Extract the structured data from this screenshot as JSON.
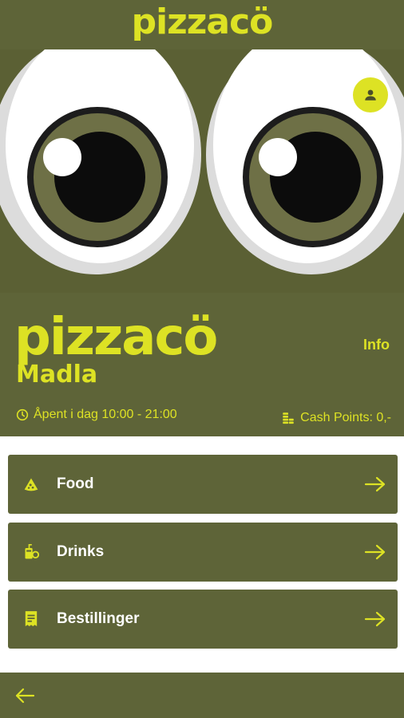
{
  "app": {
    "logo_text": "pizzacö"
  },
  "hero": {
    "profile_icon": "person-icon"
  },
  "restaurant": {
    "brand": "pizzacö",
    "location": "Madla",
    "info_label": "Info",
    "hours": "Åpent i dag 10:00 - 21:00",
    "cash_points": "Cash Points: 0,-"
  },
  "menu": [
    {
      "label": "Food",
      "icon": "pizza-slice-icon"
    },
    {
      "label": "Drinks",
      "icon": "drink-icon"
    },
    {
      "label": "Bestillinger",
      "icon": "receipt-icon"
    }
  ],
  "colors": {
    "brand_olive": "#5e6438",
    "brand_yellow": "#dde224",
    "background": "#ffffff"
  }
}
